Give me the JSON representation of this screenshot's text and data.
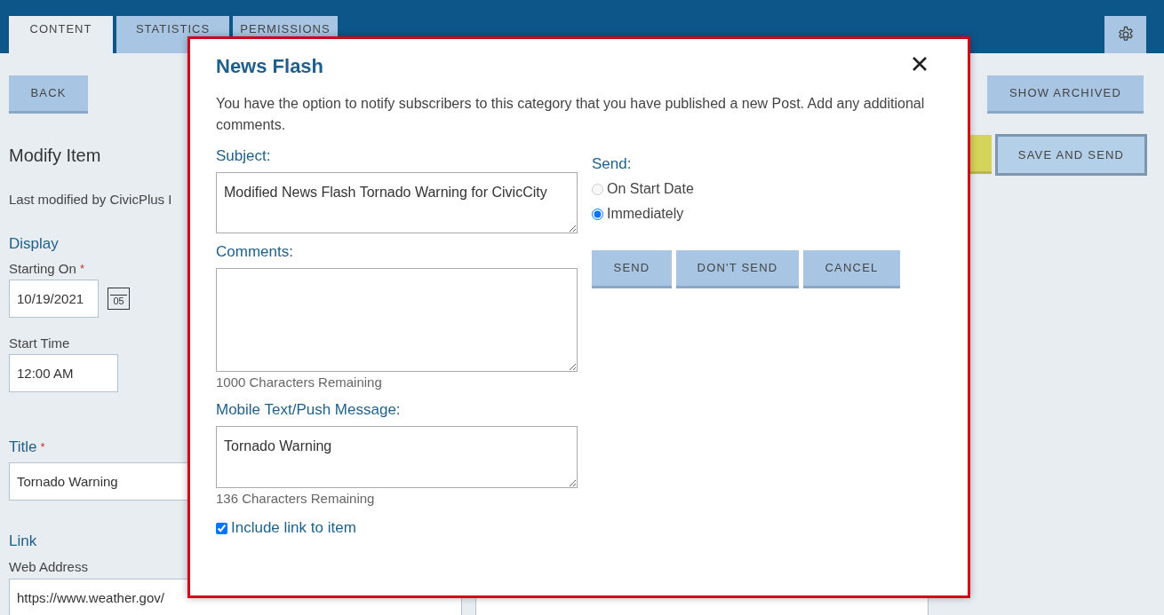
{
  "header": {
    "tabs": [
      {
        "label": "CONTENT",
        "selected": true
      },
      {
        "label": "STATISTICS",
        "selected": false
      },
      {
        "label": "PERMISSIONS",
        "selected": false
      }
    ]
  },
  "toolbar": {
    "back": "BACK",
    "show_archived": "SHOW ARCHIVED",
    "save_and_send": "SAVE AND SEND"
  },
  "form": {
    "heading": "Modify Item",
    "modified_by": "Last modified by CivicPlus I",
    "items": [
      {
        "kind": "section",
        "text": "Display"
      },
      {
        "kind": "date",
        "label": "Starting On",
        "required_mark": "*",
        "value": "10/19/2021",
        "calendar_day": "05"
      },
      {
        "kind": "input",
        "label": "Start Time",
        "value": "12:00 AM"
      },
      {
        "kind": "titled",
        "label": "Title",
        "required_mark": "*",
        "value": "Tornado Warning"
      },
      {
        "kind": "section",
        "text": "Link"
      },
      {
        "kind": "pair",
        "label": "Web Address",
        "value": "https://www.weather.gov/"
      }
    ]
  },
  "dialog": {
    "title": "News Flash",
    "description": "You have the option to notify subscribers to this category that you have published a new Post. Add any additional comments.",
    "subject": {
      "label": "Subject:",
      "value": "Modified News Flash Tornado Warning for CivicCity"
    },
    "comments": {
      "label": "Comments:",
      "counter": "1000 Characters Remaining"
    },
    "mobile": {
      "label": "Mobile Text/Push Message:",
      "value": "Tornado Warning",
      "counter": "136 Characters Remaining"
    },
    "include_link": {
      "label": "Include link to item",
      "checked": true
    },
    "send": {
      "label": "Send:",
      "options": [
        {
          "label": "On Start Date",
          "selected": false,
          "disabled": true
        },
        {
          "label": "Immediately",
          "selected": true,
          "disabled": false
        }
      ]
    },
    "buttons": [
      "SEND",
      "DON'T SEND",
      "CANCEL"
    ]
  }
}
